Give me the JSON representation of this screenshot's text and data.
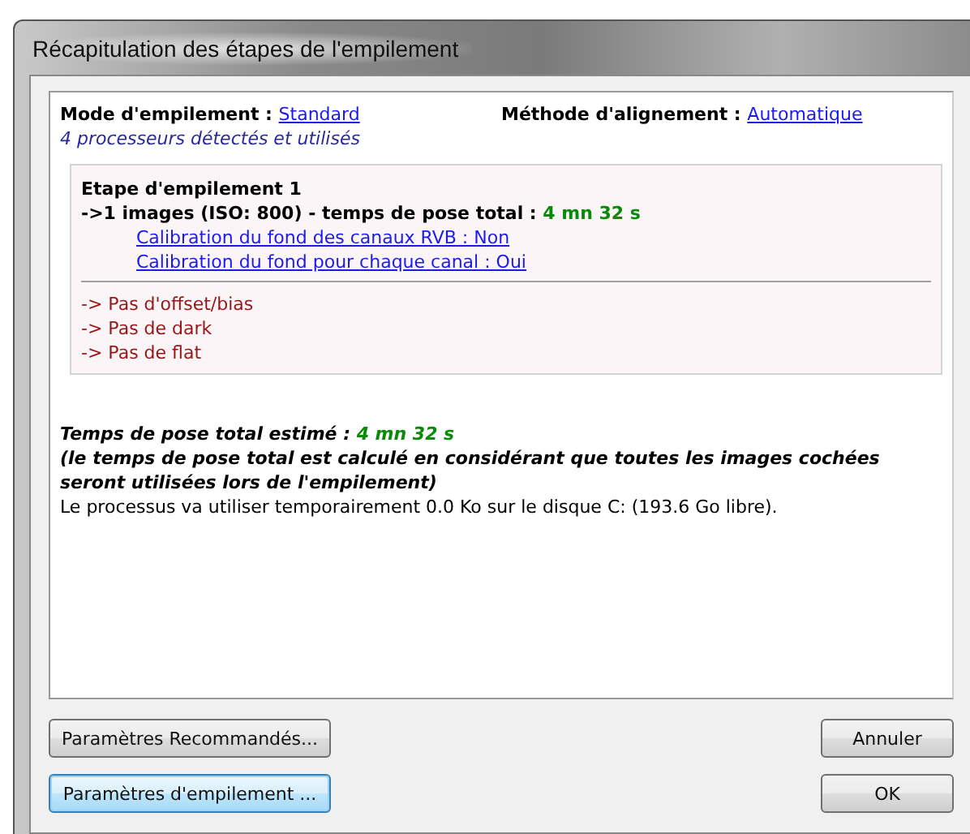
{
  "window": {
    "title": "Récapitulation des étapes de l'empilement"
  },
  "header": {
    "mode_label": "Mode d'empilement :",
    "mode_value": "Standard",
    "alignment_label": "Méthode d'alignement :",
    "alignment_value": "Automatique",
    "processors": "4 processeurs détectés et utilisés"
  },
  "stacking_step": {
    "title": "Etape d'empilement 1",
    "summary": "->1 images (ISO: 800) - temps de pose total :",
    "exposure": "4 mn 32 s",
    "calibration_links": [
      "Calibration du fond des canaux RVB : Non",
      "Calibration du fond pour chaque canal : Oui"
    ],
    "warnings": [
      "-> Pas d'offset/bias",
      "-> Pas de dark",
      "-> Pas de flat"
    ]
  },
  "total": {
    "label": "Temps de pose total estimé :",
    "value": "4 mn 32 s",
    "note": "(le temps de pose total est calculé en considérant que toutes les images cochées seront utilisées lors de l'empilement)",
    "disk": "Le processus va utiliser temporairement 0.0 Ko sur le disque C: (193.6 Go libre)."
  },
  "button_rows": [
    [
      {
        "label": "Paramètres Recommandés...",
        "focused": false
      },
      {
        "label": "Annuler",
        "focused": false
      }
    ],
    [
      {
        "label": "Paramètres d'empilement ...",
        "focused": true
      },
      {
        "label": "OK",
        "focused": false
      }
    ]
  ]
}
